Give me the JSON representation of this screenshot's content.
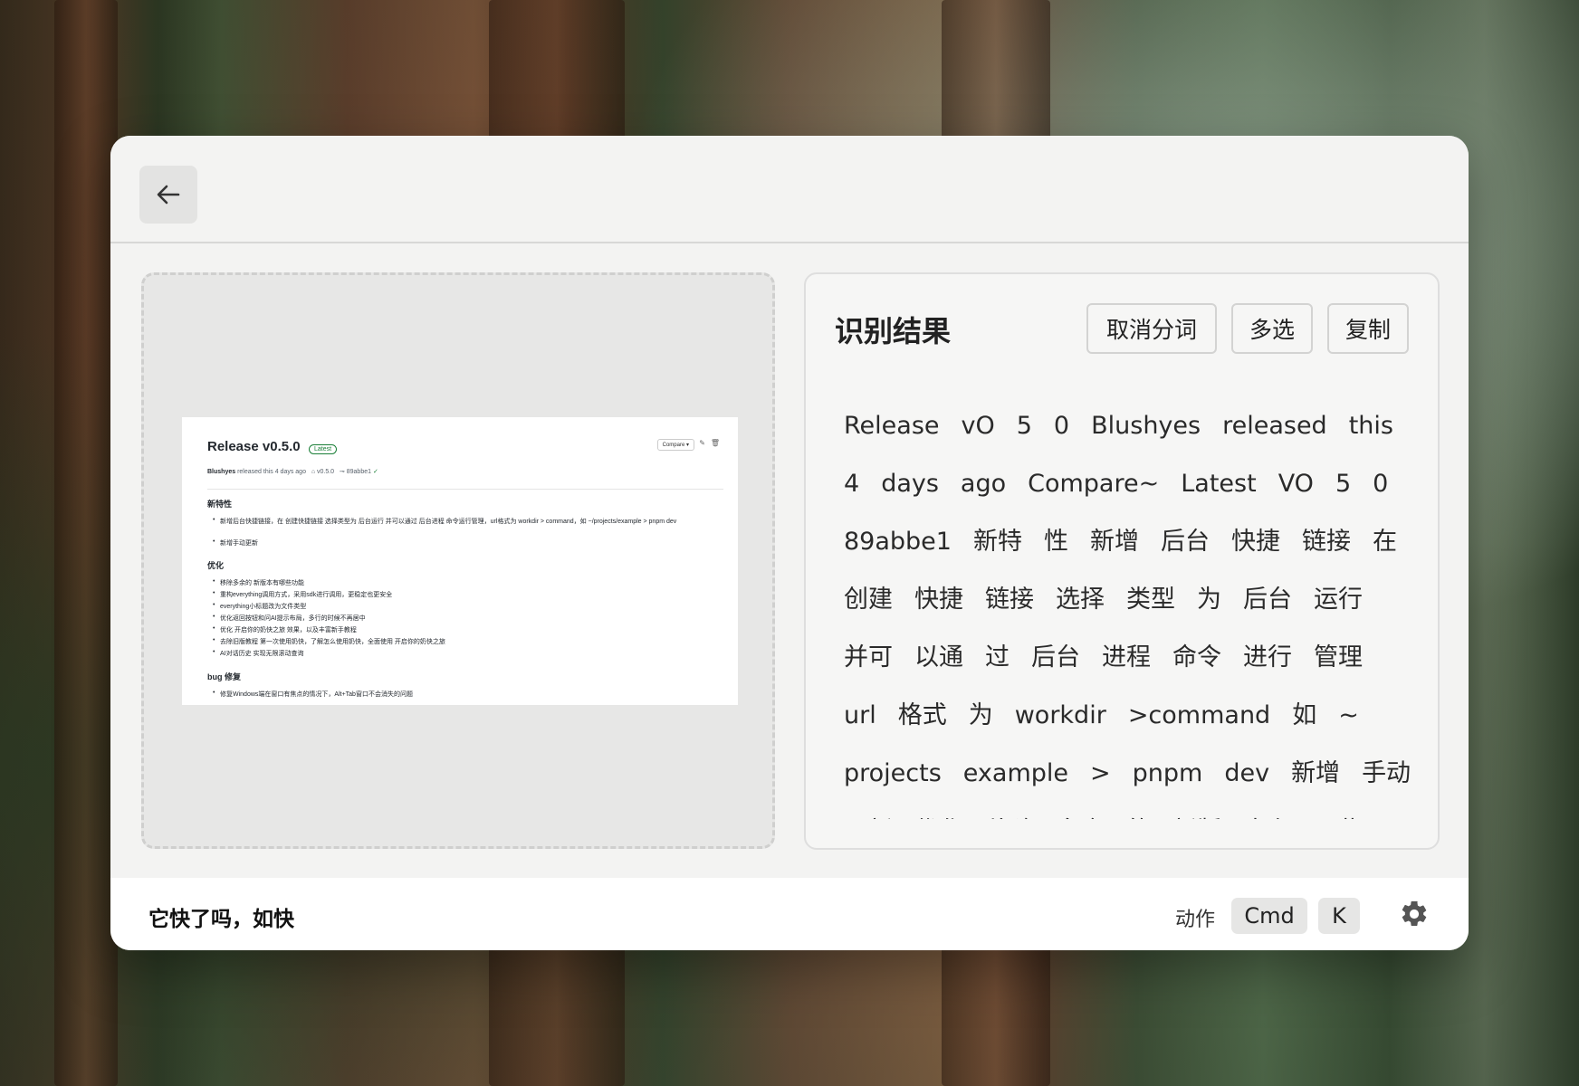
{
  "window": {
    "back_label": "back"
  },
  "preview": {
    "release_title": "Release v0.5.0",
    "latest_badge": "Latest",
    "compare_label": "Compare",
    "meta_author": "Blushyes",
    "meta_text": "released this 4 days ago",
    "meta_tag": "v0.5.0",
    "meta_commit": "89abbe1",
    "section_new": "新特性",
    "new_items": [
      "新增后台快捷链接，在 创建快捷链接 选择类型为 后台运行 并可以通过 后台进程 命令运行管理，url格式为 workdir > command，如 ~/projects/example > pnpm dev",
      "新增手动更新"
    ],
    "section_opt": "优化",
    "opt_items": [
      "移除多余的 新版本有哪些功能",
      "重构everything调用方式，采用sdk进行调用，更稳定也更安全",
      "everything小标题改为文件类型",
      "优化返回按钮和问AI提示布局，多行的时候不再居中",
      "优化 开启你的奶快之旅 效果，以及丰富新手教程",
      "去除旧版教程 第一次使用奶快，了解怎么使用奶快，全面使用 开启你的奶快之旅",
      "AI对话历史 实现无限滚动查询"
    ],
    "section_bug": "bug 修复",
    "bug_items": [
      "修复Windows端在窗口有焦点的情况下，Alt+Tab窗口不会消失的问题"
    ]
  },
  "result": {
    "title": "识别结果",
    "cancel_seg_label": "取消分词",
    "multi_select_label": "多选",
    "copy_label": "复制",
    "tokens": [
      "Release",
      "vO",
      "5",
      "0",
      "Blushyes",
      "released",
      "this",
      "4",
      "days",
      "ago",
      "Compare~",
      "Latest",
      "VO",
      "5",
      "0",
      "89abbe1",
      "新特",
      "性",
      "新增",
      "后台",
      "快捷",
      "链接",
      "在",
      "创建",
      "快捷",
      "链接",
      "选择",
      "类型",
      "为",
      "后台",
      "运行",
      "并可",
      "以通",
      "过",
      "后台",
      "进程",
      "命令",
      "进行",
      "管理",
      "url",
      "格式",
      "为",
      "workdir",
      ">command",
      "如",
      "~",
      "projects",
      "example",
      ">",
      "pnpm",
      "dev",
      "新增",
      "手动",
      "更新",
      "优化",
      "移除",
      "多余",
      "的",
      "新版",
      "本有",
      "哪些"
    ]
  },
  "footer": {
    "status_text": "它快了吗，如快",
    "action_label": "动作",
    "key_cmd": "Cmd",
    "key_k": "K"
  },
  "icons": [
    "arrow-left-icon",
    "gear-icon",
    "pencil-icon",
    "trash-icon",
    "tag-icon",
    "commit-icon",
    "check-circle-icon"
  ]
}
